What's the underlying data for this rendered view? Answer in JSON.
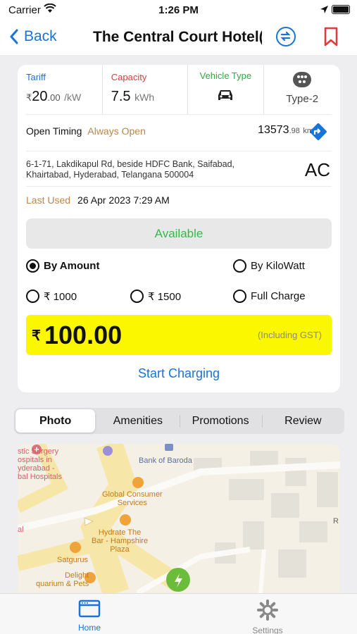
{
  "status_bar": {
    "carrier": "Carrier",
    "time": "1:26 PM"
  },
  "nav": {
    "back_label": "Back",
    "title": "The Central Court Hotel("
  },
  "metrics": {
    "tariff_label": "Tariff",
    "tariff_symbol": "₹",
    "tariff_value": "20",
    "tariff_decimal": ".00",
    "tariff_unit": "/kW",
    "capacity_label": "Capacity",
    "capacity_value": "7.5",
    "capacity_unit": "kWh",
    "vehicle_type_label": "Vehicle Type",
    "connector_type": "Type-2"
  },
  "timing": {
    "label": "Open Timing",
    "value": "Always Open"
  },
  "distance": {
    "value": "13573",
    "decimal": ".98",
    "unit": "km"
  },
  "address": "6-1-71, Lakdikapul Rd, beside HDFC Bank, Saifabad, Khairtabad, Hyderabad, Telangana 500004",
  "current_type": "AC",
  "last_used": {
    "label": "Last Used",
    "value": "26 Apr 2023 7:29 AM"
  },
  "availability": "Available",
  "mode_options": {
    "by_amount": "By Amount",
    "by_kilowatt": "By KiloWatt"
  },
  "preset_options": {
    "p1000": "₹ 1000",
    "p1500": "₹ 1500",
    "full": "Full Charge"
  },
  "amount": {
    "symbol": "₹",
    "value": "100.00",
    "note": "(Including GST)"
  },
  "start_button": "Start Charging",
  "tabs": [
    "Photo",
    "Amenities",
    "Promotions",
    "Review"
  ],
  "map": {
    "pois": {
      "surgery": "stic Surgery\nospitals in\nyderabad -\nbal Hospitals",
      "bank": "Bank of Baroda",
      "consumer": "Global Consumer\nServices",
      "hydrate": "Hydrate The\nBar - Hampshire\nPlaza",
      "satgurus": "Satgurus",
      "delight": "Delight\nquarium & Pets",
      "al": "al",
      "r": "R"
    }
  },
  "tabbar": {
    "home": "Home",
    "settings": "Settings"
  },
  "colors": {
    "accent": "#1a73d6",
    "available": "#35b84a",
    "amount_bg": "#fbf700",
    "bookmark": "#e03a3a"
  }
}
